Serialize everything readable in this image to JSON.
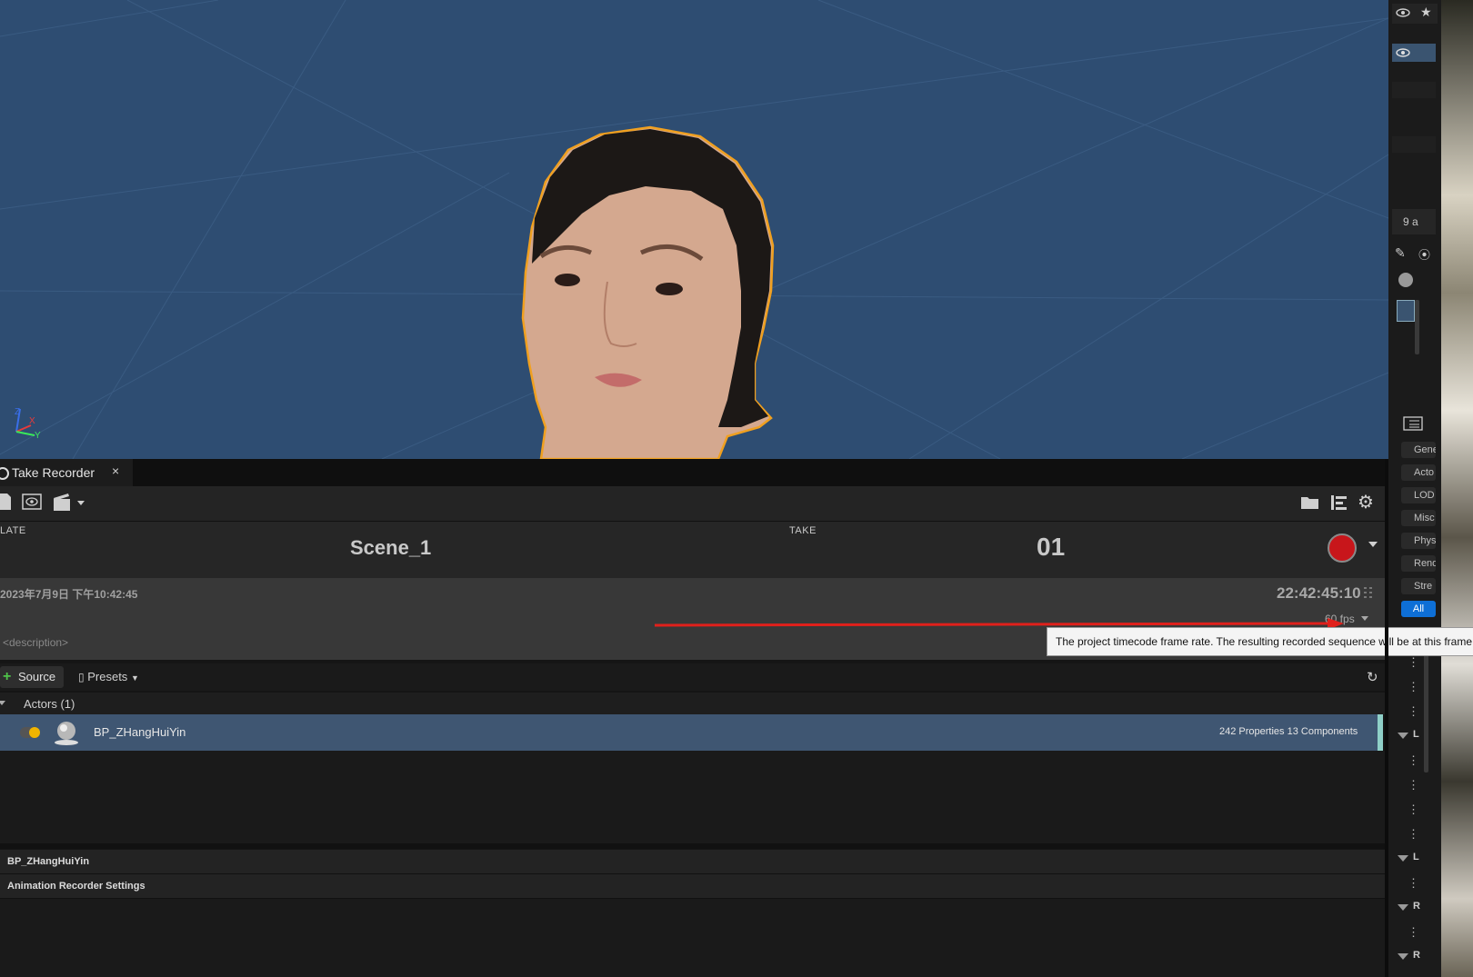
{
  "viewport": {
    "axis_labels": [
      "Z",
      "X",
      "Y"
    ]
  },
  "right_panel": {
    "counter_text": "9 a",
    "category_buttons": [
      "Gene",
      "Acto",
      "LOD",
      "Misc",
      "Phys",
      "Rend",
      "Stre",
      "All"
    ],
    "section_letters": [
      "L",
      "L",
      "R",
      "R"
    ]
  },
  "take_recorder": {
    "tab_title": "Take Recorder",
    "tab_close": "×",
    "slate_label": "LATE",
    "slate_value": "Scene_1",
    "take_label": "TAKE",
    "take_value": "01",
    "date_text": "2023年7月9日 下午10:42:45",
    "timecode": "22:42:45:10",
    "fps": "60 fps",
    "description_placeholder": "<description>",
    "tooltip": "The project timecode frame rate. The resulting recorded sequence will be at this frame",
    "add_source_label": "Source",
    "presets_label": "Presets",
    "actors_header": "Actors (1)",
    "actor": {
      "name": "BP_ZHangHuiYin",
      "properties": "242 Properties 13 Components"
    },
    "details_sections": [
      "BP_ZHangHuiYin",
      "Animation Recorder Settings"
    ]
  },
  "colors": {
    "viewport_bg": "#2e4d72",
    "selection_outline": "#f0a020",
    "record": "#c8161b",
    "selected_row": "#3f5672",
    "active_category": "#0e6fd6",
    "annotation_arrow": "#e0201b"
  }
}
